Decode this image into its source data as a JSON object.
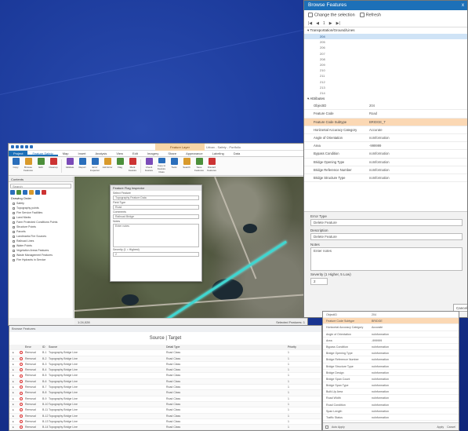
{
  "pro": {
    "context_tab": "Feature Layer",
    "project_title": "Urban - Safety - Portfolio",
    "tabs": [
      "Project",
      "Feature Safety",
      "Map",
      "Insert",
      "Analysis",
      "View",
      "Edit",
      "Imagery",
      "Share",
      "Appearance",
      "Labeling",
      "Data"
    ],
    "ribbon": [
      "Copy",
      "Browse Features",
      "Edit",
      "Cleanup",
      "Validate",
      "Report",
      "Error Inspector",
      "Add Error",
      "Flag",
      "Mark Feature",
      "Check Feature",
      "Copy to Feature Class",
      "Tools",
      "Search",
      "Save Features",
      "Discard Features"
    ],
    "contents_title": "Contents",
    "contents_search": "Search",
    "drawing_order": "Drawing Order",
    "layers": [
      "Safety",
      "Topography points",
      "Fire Service Facilities",
      "Land Marks",
      "Farm Protected Conditions Points",
      "Structure Points",
      "Parcels",
      "Landmarks Fire Sources",
      "Railroad Lines",
      "Water Points",
      "Vegetation Areas Features",
      "Waste Management Features",
      "Fire Hydrants in Service"
    ],
    "popup": {
      "title": "Feature Flag Inspector",
      "fields": [
        {
          "label": "Select Feature",
          "value": "Topography Feature Data"
        },
        {
          "label": "Field Type",
          "value": "Road"
        },
        {
          "label": "Comments",
          "value": "Railroad Bridge"
        },
        {
          "label": "Notes",
          "value": "Enter notes"
        },
        {
          "label": "Severity (1 = Highest)",
          "value": "2"
        }
      ]
    },
    "status": {
      "scale": "1:24,028",
      "coords": "Selected Features: 1"
    }
  },
  "browse": {
    "title": "Browse Features",
    "close_label": "x",
    "change_selection": "Change the selection",
    "refresh": "Refresh",
    "nav": [
      "|◀",
      "◀",
      "1",
      "▶",
      "▶|"
    ],
    "group_label": "Transportation/Ground/Lines",
    "oids": [
      "204",
      "205",
      "206",
      "207",
      "208",
      "209",
      "210",
      "211",
      "212",
      "213",
      "214"
    ],
    "selected_oid": "204",
    "attributes_label": "Attributes",
    "attributes": [
      {
        "name": "ObjectID",
        "value": "204"
      },
      {
        "name": "Feature Code",
        "value": "Road"
      },
      {
        "name": "Feature Code Subtype",
        "value": "BRIDGE_T"
      },
      {
        "name": "Horizontal Accuracy Category",
        "value": "Accurate"
      },
      {
        "name": "Angle of Orientation",
        "value": "noInformation"
      },
      {
        "name": "Area",
        "value": "-999999"
      },
      {
        "name": "Bypass Condition",
        "value": "noInformation"
      },
      {
        "name": "Bridge Opening Type",
        "value": "noInformation"
      },
      {
        "name": "Bridge Reference Number",
        "value": "noInformation"
      },
      {
        "name": "Bridge Structure Type",
        "value": "noInformation"
      }
    ],
    "highlighted_index": 2,
    "form": {
      "error_type_label": "Error Type",
      "error_type_value": "Delete Feature",
      "description_label": "Description",
      "description_value": "Delete Feature",
      "notes_label": "Notes",
      "notes_value": "Enter notes",
      "severity_label": "Severity (1 Higher, 5 Low)",
      "severity_value": "2",
      "cancel": "Cancel"
    }
  },
  "table": {
    "header": "Browse Features",
    "subtitle": "Source  |  Target",
    "columns": [
      "",
      "Error",
      "ID",
      "Source",
      "Detail Type",
      "Priority"
    ],
    "rows": [
      {
        "icon": "x",
        "type": "Removal",
        "id": "B-1",
        "src": "Topography Bridge Line",
        "detail": "Road Class",
        "pri": "1"
      },
      {
        "icon": "x",
        "type": "Removal",
        "id": "B-2",
        "src": "Topography Bridge Line",
        "detail": "Road Class",
        "pri": "1"
      },
      {
        "icon": "x",
        "type": "Removal",
        "id": "B-3",
        "src": "Topography Bridge Line",
        "detail": "Road Class",
        "pri": "1"
      },
      {
        "icon": "x",
        "type": "Removal",
        "id": "B-4",
        "src": "Topography Bridge Line",
        "detail": "Road Class",
        "pri": "1"
      },
      {
        "icon": "x",
        "type": "Removal",
        "id": "B-5",
        "src": "Topography Bridge Line",
        "detail": "Road Class",
        "pri": "1"
      },
      {
        "icon": "x",
        "type": "Removal",
        "id": "B-6",
        "src": "Topography Bridge Line",
        "detail": "Road Class",
        "pri": "1"
      },
      {
        "icon": "x",
        "type": "Removal",
        "id": "B-7",
        "src": "Topography Bridge Line",
        "detail": "Road Class",
        "pri": "1"
      },
      {
        "icon": "x",
        "type": "Removal",
        "id": "B-8",
        "src": "Topography Bridge Line",
        "detail": "Road Class",
        "pri": "1"
      },
      {
        "icon": "x",
        "type": "Removal",
        "id": "B-9",
        "src": "Topography Bridge Line",
        "detail": "Road Class",
        "pri": "1"
      },
      {
        "icon": "x",
        "type": "Removal",
        "id": "B-10",
        "src": "Topography Bridge Line",
        "detail": "Road Class",
        "pri": "1"
      },
      {
        "icon": "x",
        "type": "Removal",
        "id": "B-11",
        "src": "Topography Bridge Line",
        "detail": "Road Class",
        "pri": "1"
      },
      {
        "icon": "x",
        "type": "Removal",
        "id": "B-12",
        "src": "Topography Bridge Line",
        "detail": "Road Class",
        "pri": "1"
      },
      {
        "icon": "x",
        "type": "Removal",
        "id": "B-13",
        "src": "Topography Bridge Line",
        "detail": "Road Class",
        "pri": "1"
      },
      {
        "icon": "x",
        "type": "Removal",
        "id": "B-14",
        "src": "Topography Bridge Line",
        "detail": "Road Class",
        "pri": "1"
      }
    ]
  },
  "small_attrs": {
    "rows": [
      {
        "name": "ObjectID",
        "value": "204"
      },
      {
        "name": "Feature Code Subtype",
        "value": "BRIDGE"
      },
      {
        "name": "Horizontal Accuracy Category",
        "value": "Accurate"
      },
      {
        "name": "Angle of Orientation",
        "value": "noInformation"
      },
      {
        "name": "Area",
        "value": "-999999"
      },
      {
        "name": "Bypass Condition",
        "value": "noInformation"
      },
      {
        "name": "Bridge Opening Type",
        "value": "noInformation"
      },
      {
        "name": "Bridge Reference Number",
        "value": "noInformation"
      },
      {
        "name": "Bridge Structure Type",
        "value": "noInformation"
      },
      {
        "name": "Bridge Design",
        "value": "noInformation"
      },
      {
        "name": "Bridge Span Count",
        "value": "noInformation"
      },
      {
        "name": "Bridge Span Type",
        "value": "noInformation"
      },
      {
        "name": "Built-Up Area",
        "value": "noInformation"
      },
      {
        "name": "Road Width",
        "value": "noInformation"
      },
      {
        "name": "Road Condition",
        "value": "noInformation"
      },
      {
        "name": "Span Length",
        "value": "noInformation"
      },
      {
        "name": "Traffic Status",
        "value": "noInformation"
      }
    ],
    "highlighted_index": 1,
    "footer_check": "Auto Apply",
    "footer_buttons": [
      "Apply",
      "Cancel"
    ]
  },
  "colors": {
    "accent": "#1d70b8",
    "background": "#1a3898",
    "highlight": "#fbd8b4",
    "selection": "#3fd6d0"
  }
}
